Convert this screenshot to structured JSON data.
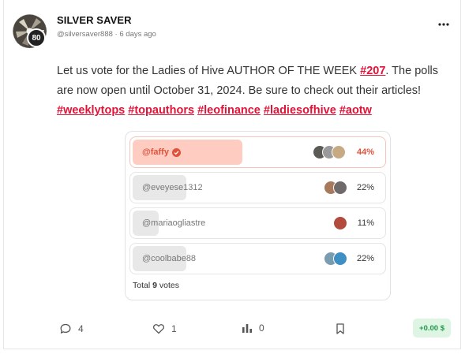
{
  "post": {
    "author_name": "SILVER SAVER",
    "author_handle": "@silversaver888",
    "separator": "·",
    "time_ago": "6 days ago",
    "level": "80",
    "menu_icon": "more-horizontal-icon",
    "body_text_1": "Let us vote for the Ladies of Hive AUTHOR OF THE WEEK ",
    "body_link_1": "#207",
    "body_text_2": ". The polls are now open until October 31, 2024. Be sure to check out their articles!",
    "tags": [
      "#weeklytops",
      "#topauthors",
      "#leofinance",
      "#ladiesofhive",
      "#aotw"
    ]
  },
  "poll": {
    "options": [
      {
        "label": "@faffy",
        "percent": "44%",
        "share": 0.44
      },
      {
        "label": "@eveyese1312",
        "percent": "22%",
        "share": 0.22
      },
      {
        "label": "@mariaogliastre",
        "percent": "11%",
        "share": 0.11
      },
      {
        "label": "@coolbabe88",
        "percent": "22%",
        "share": 0.22
      }
    ],
    "total_label": "Total",
    "total_votes": "9",
    "votes_label": "votes"
  },
  "actions": {
    "comments": "4",
    "likes": "1",
    "reblogs": "0",
    "payout": "+0.00 $"
  },
  "colors": {
    "accent": "#e31337",
    "winner_fill": "#ffccc2",
    "payout_bg": "#dff5e3",
    "payout_text": "#1d9a4a"
  }
}
